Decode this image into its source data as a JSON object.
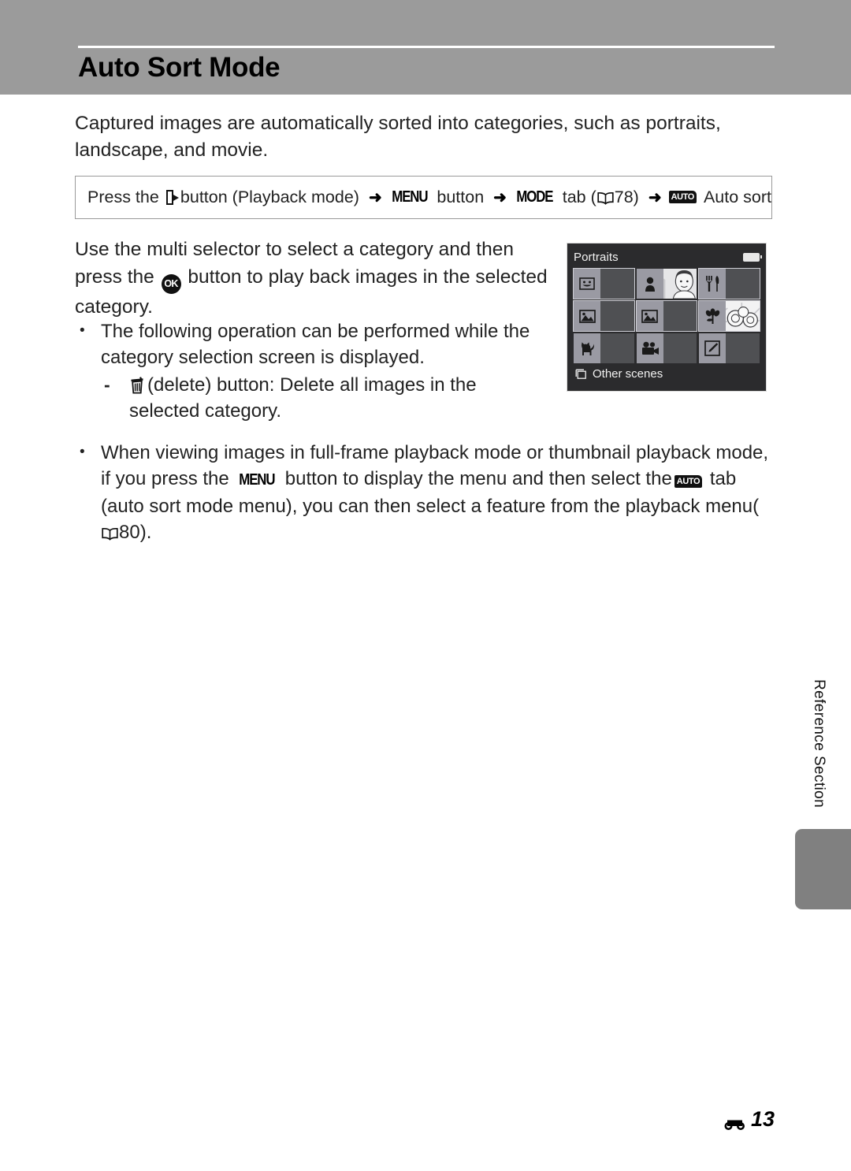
{
  "page": {
    "title": "Auto Sort Mode",
    "footer_marker_icon": "e-section-icon",
    "footer_page": "13",
    "side_tab_label": "Reference Section"
  },
  "intro": {
    "text": "Captured images are automatically sorted into categories, such as portraits, landscape, and movie."
  },
  "nav_path": {
    "prefix": "Press the",
    "play_icon": "playback-icon",
    "after_play": "button (Playback mode)",
    "arrow1": "➜",
    "menu_icon_label": "MENU",
    "after_menu": "button",
    "arrow2": "➜",
    "mode_icon_label": "MODE",
    "after_mode": "tab",
    "book_ref_open": "(",
    "book_icon": "book-icon",
    "book_page": "78)",
    "arrow3": "➜",
    "auto_icon_label": "AUTO",
    "after_auto": "Auto sort"
  },
  "body": {
    "para_main_part1": "Use the multi selector to select a category and then press the",
    "ok_icon_label": "OK",
    "para_main_part2": "button to play back images in the selected category.",
    "bullet1": "The following operation can be performed while the category selection screen is displayed.",
    "subbullet1_icon": "trash-icon",
    "subbullet1": "(delete) button: Delete all images in the selected category.",
    "bullet2_part1": "When viewing images in full-frame playback mode or thumbnail playback mode, if you press the",
    "bullet2_menu_label": "MENU",
    "bullet2_part2": "button to display the menu and then select the",
    "bullet2_auto_label": "AUTO",
    "bullet2_part3": "tab (auto sort mode menu), you can then select a feature from the playback menu",
    "bullet2_ref_open": "(",
    "bullet2_book_icon": "book-icon",
    "bullet2_page": "80)."
  },
  "lcd": {
    "title": "Portraits",
    "battery_icon": "battery-icon",
    "bottom_icon": "stack-icon",
    "bottom_label": "Other scenes",
    "cells": [
      {
        "name": "smile-category",
        "icon": "smile-icon",
        "selected": true,
        "photo": false
      },
      {
        "name": "portraits-category",
        "icon": "person-icon",
        "selected": false,
        "photo": true
      },
      {
        "name": "food-category",
        "icon": "cutlery-icon",
        "selected": true,
        "photo": false
      },
      {
        "name": "landscape-category",
        "icon": "landscape-icon",
        "selected": true,
        "photo": false
      },
      {
        "name": "night-landscape-category",
        "icon": "night-landscape-icon",
        "selected": true,
        "photo": false
      },
      {
        "name": "close-up-category",
        "icon": "flower-icon",
        "selected": true,
        "photo": true
      },
      {
        "name": "pet-portrait-category",
        "icon": "cat-icon",
        "selected": false,
        "photo": false
      },
      {
        "name": "movie-category",
        "icon": "movie-camera-icon",
        "selected": false,
        "photo": false
      },
      {
        "name": "retouched-category",
        "icon": "retouch-icon",
        "selected": false,
        "photo": false
      }
    ]
  },
  "colors": {
    "header_band": "#9b9b9b",
    "side_tab": "#808080",
    "lcd_background": "#2b2b2d",
    "lcd_cell": "#4f5053"
  }
}
